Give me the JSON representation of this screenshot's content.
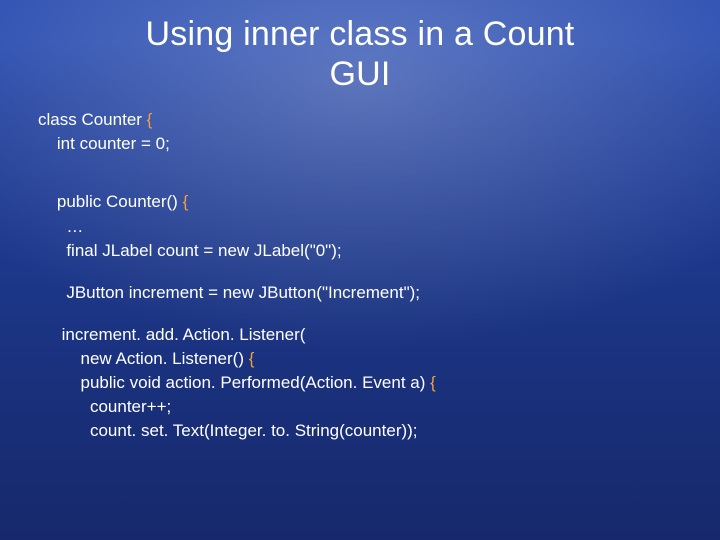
{
  "title_line1": "Using inner class in a Count",
  "title_line2": "GUI",
  "code_lines": {
    "l1a": "class Counter ",
    "l1b": "{",
    "l2": "    int counter = 0;",
    "l3": "    public Counter() ",
    "l3b": "{",
    "l4": "      …",
    "l5": "      final JLabel count = new JLabel(\"0\");",
    "l6": "      JButton increment = new JButton(\"Increment\");",
    "l7": "     increment. add. Action. Listener(",
    "l8": "         new Action. Listener() ",
    "l8b": "{",
    "l9": "         public void action. Performed(Action. Event a) ",
    "l9b": "{",
    "l10": "           counter++;",
    "l11": "           count. set. Text(Integer. to. String(counter));"
  }
}
